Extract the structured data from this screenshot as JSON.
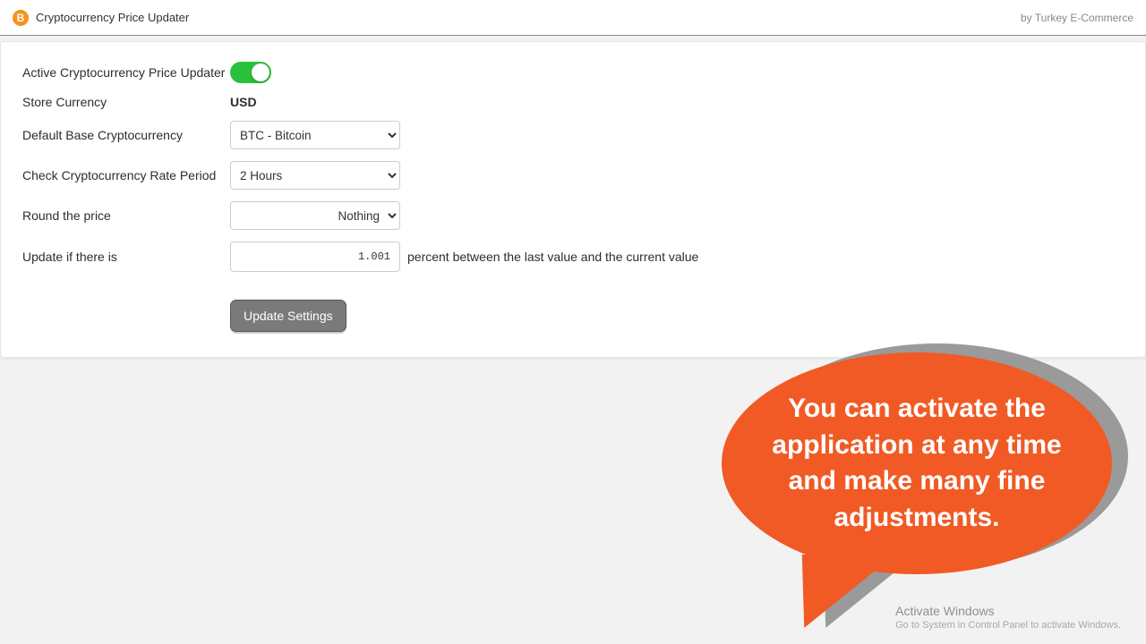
{
  "header": {
    "title": "Cryptocurrency Price Updater",
    "by": "by Turkey E-Commerce"
  },
  "form": {
    "active_label": "Active Cryptocurrency Price Updater",
    "store_currency_label": "Store Currency",
    "store_currency_value": "USD",
    "base_label": "Default Base Cryptocurrency",
    "base_selected": "BTC - Bitcoin",
    "period_label": "Check Cryptocurrency Rate Period",
    "period_selected": "2 Hours",
    "round_label": "Round the price",
    "round_selected": "Nothing",
    "update_if_label": "Update if there is",
    "update_if_value": "1.001",
    "update_if_helper": "percent between the last value and the current value",
    "submit_label": "Update Settings"
  },
  "bubble": {
    "text": "You can activate the application at any time and make many fine adjustments."
  },
  "watermark": {
    "line1": "Activate Windows",
    "line2": "Go to System in Control Panel to activate Windows."
  }
}
